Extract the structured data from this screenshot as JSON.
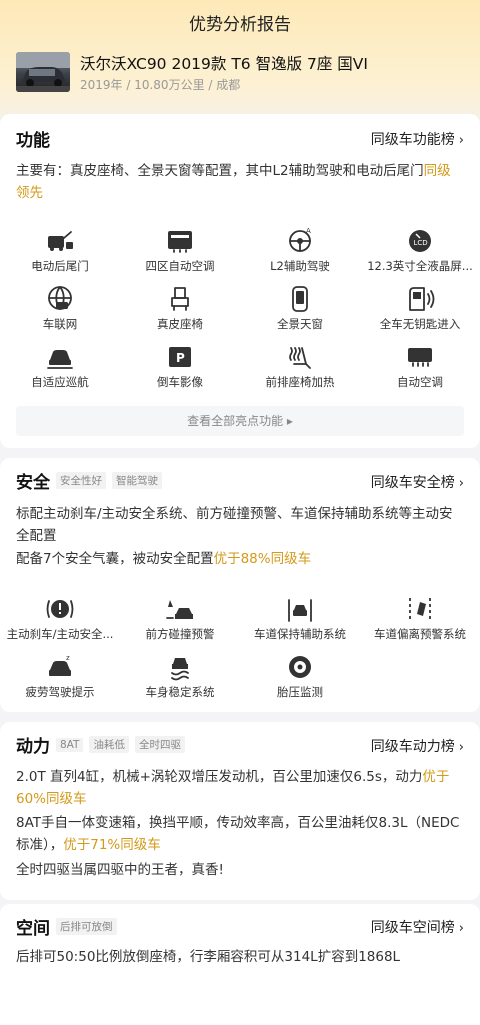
{
  "page_title": "优势分析报告",
  "car": {
    "name": "沃尔沃XC90 2019款 T6 智逸版 7座 国VI",
    "meta": "2019年 / 10.80万公里 / 成都"
  },
  "function": {
    "title": "功能",
    "rank_link": "同级车功能榜",
    "desc_main": "主要有：真皮座椅、全景天窗等配置，其中L2辅助驾驶和电动后尾门",
    "desc_highlight": "同级领先",
    "features": [
      {
        "label": "电动后尾门",
        "icon": "power-tailgate-icon"
      },
      {
        "label": "四区自动空调",
        "icon": "four-zone-ac-icon"
      },
      {
        "label": "L2辅助驾驶",
        "icon": "l2-assist-icon"
      },
      {
        "label": "12.3英寸全液晶屏...",
        "icon": "lcd-dashboard-icon"
      },
      {
        "label": "车联网",
        "icon": "connected-car-icon"
      },
      {
        "label": "真皮座椅",
        "icon": "leather-seat-icon"
      },
      {
        "label": "全景天窗",
        "icon": "panoramic-roof-icon"
      },
      {
        "label": "全车无钥匙进入",
        "icon": "keyless-entry-icon"
      },
      {
        "label": "自适应巡航",
        "icon": "adaptive-cruise-icon"
      },
      {
        "label": "倒车影像",
        "icon": "reverse-camera-icon"
      },
      {
        "label": "前排座椅加热",
        "icon": "seat-heating-icon"
      },
      {
        "label": "自动空调",
        "icon": "auto-ac-icon"
      }
    ],
    "view_all": "查看全部亮点功能 ▸"
  },
  "safety": {
    "title": "安全",
    "tags": [
      "安全性好",
      "智能驾驶"
    ],
    "rank_link": "同级车安全榜",
    "desc1": "标配主动刹车/主动安全系统、前方碰撞预警、车道保持辅助系统等主动安全配置",
    "desc2_main": "配备7个安全气囊，被动安全配置",
    "desc2_highlight": "优于88%同级车",
    "features": [
      {
        "label": "主动刹车/主动安全...",
        "icon": "active-brake-icon"
      },
      {
        "label": "前方碰撞预警",
        "icon": "collision-warning-icon"
      },
      {
        "label": "车道保持辅助系统",
        "icon": "lane-keep-icon"
      },
      {
        "label": "车道偏离预警系统",
        "icon": "lane-departure-icon"
      },
      {
        "label": "疲劳驾驶提示",
        "icon": "fatigue-alert-icon"
      },
      {
        "label": "车身稳定系统",
        "icon": "stability-control-icon"
      },
      {
        "label": "胎压监测",
        "icon": "tire-pressure-icon"
      }
    ]
  },
  "power": {
    "title": "动力",
    "tags": [
      "8AT",
      "油耗低",
      "全时四驱"
    ],
    "rank_link": "同级车动力榜",
    "desc1_main": "2.0T 直列4缸，机械+涡轮双增压发动机，百公里加速仅6.5s，动力",
    "desc1_highlight": "优于60%同级车",
    "desc2_main": "8AT手自一体变速箱，换挡平顺，传动效率高，百公里油耗仅8.3L（NEDC标准），",
    "desc2_highlight": "优于71%同级车",
    "desc3": "全时四驱当属四驱中的王者，真香!"
  },
  "space": {
    "title": "空间",
    "tags": [
      "后排可放倒"
    ],
    "rank_link": "同级车空间榜",
    "desc": "后排可50:50比例放倒座椅，行李厢容积可从314L扩容到1868L"
  },
  "colors": {
    "accent": "#d39a1a",
    "header_bg": "#fde9b8"
  }
}
